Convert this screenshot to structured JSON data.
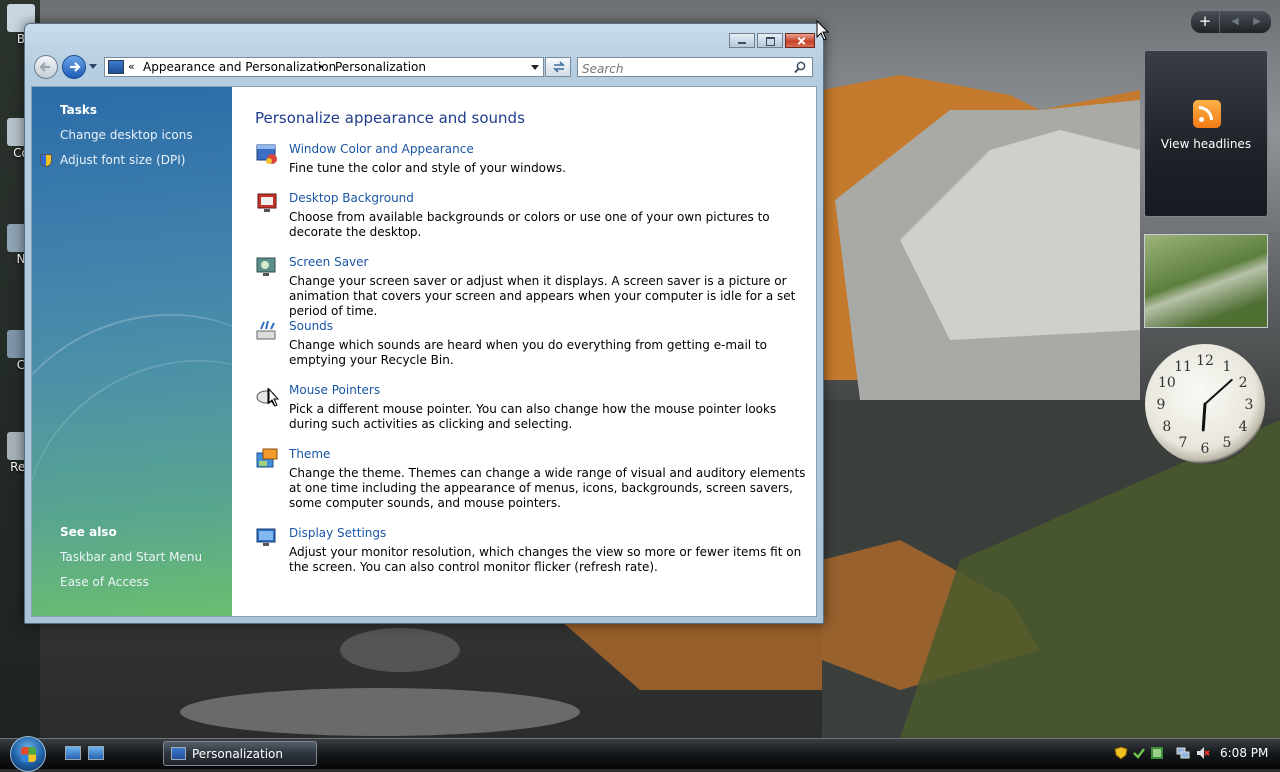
{
  "desktop": {
    "icon_labels": [
      "B",
      "Co",
      "N",
      "C",
      "Rec"
    ]
  },
  "gadgets": {
    "feed_label": "View headlines",
    "clock": {
      "hour": 6,
      "minute": 8,
      "numerals": [
        "12",
        "1",
        "2",
        "3",
        "4",
        "5",
        "6",
        "7",
        "8",
        "9",
        "10",
        "11"
      ]
    }
  },
  "window": {
    "address": {
      "overflow": "«",
      "crumbs": [
        "Appearance and Personalization",
        "Personalization"
      ],
      "separator": "▸"
    },
    "search_placeholder": "Search",
    "tasks": {
      "heading": "Tasks",
      "links": [
        "Change desktop icons",
        "Adjust font size (DPI)"
      ]
    },
    "see_also": {
      "heading": "See also",
      "links": [
        "Taskbar and Start Menu",
        "Ease of Access"
      ]
    },
    "main_heading": "Personalize appearance and sounds",
    "items": [
      {
        "title": "Window Color and Appearance",
        "desc": "Fine tune the color and style of your windows."
      },
      {
        "title": "Desktop Background",
        "desc": "Choose from available backgrounds or colors or use one of your own pictures to decorate the desktop."
      },
      {
        "title": "Screen Saver",
        "desc": "Change your screen saver or adjust when it displays. A screen saver is a picture or animation that covers your screen and appears when your computer is idle for a set period of time."
      },
      {
        "title": "Sounds",
        "desc": "Change which sounds are heard when you do everything from getting e-mail to emptying your Recycle Bin."
      },
      {
        "title": "Mouse Pointers",
        "desc": "Pick a different mouse pointer. You can also change how the mouse pointer looks during such activities as clicking and selecting."
      },
      {
        "title": "Theme",
        "desc": "Change the theme. Themes can change a wide range of visual and auditory elements at one time including the appearance of menus, icons, backgrounds, screen savers, some computer sounds, and mouse pointers."
      },
      {
        "title": "Display Settings",
        "desc": "Adjust your monitor resolution, which changes the view so more or fewer items fit on the screen. You can also control monitor flicker (refresh rate)."
      }
    ]
  },
  "taskbar": {
    "active_window": "Personalization",
    "time": "6:08 PM"
  },
  "colors": {
    "link": "#1a56a5",
    "heading": "#1e3c8c",
    "close_button": "#c5422a"
  }
}
